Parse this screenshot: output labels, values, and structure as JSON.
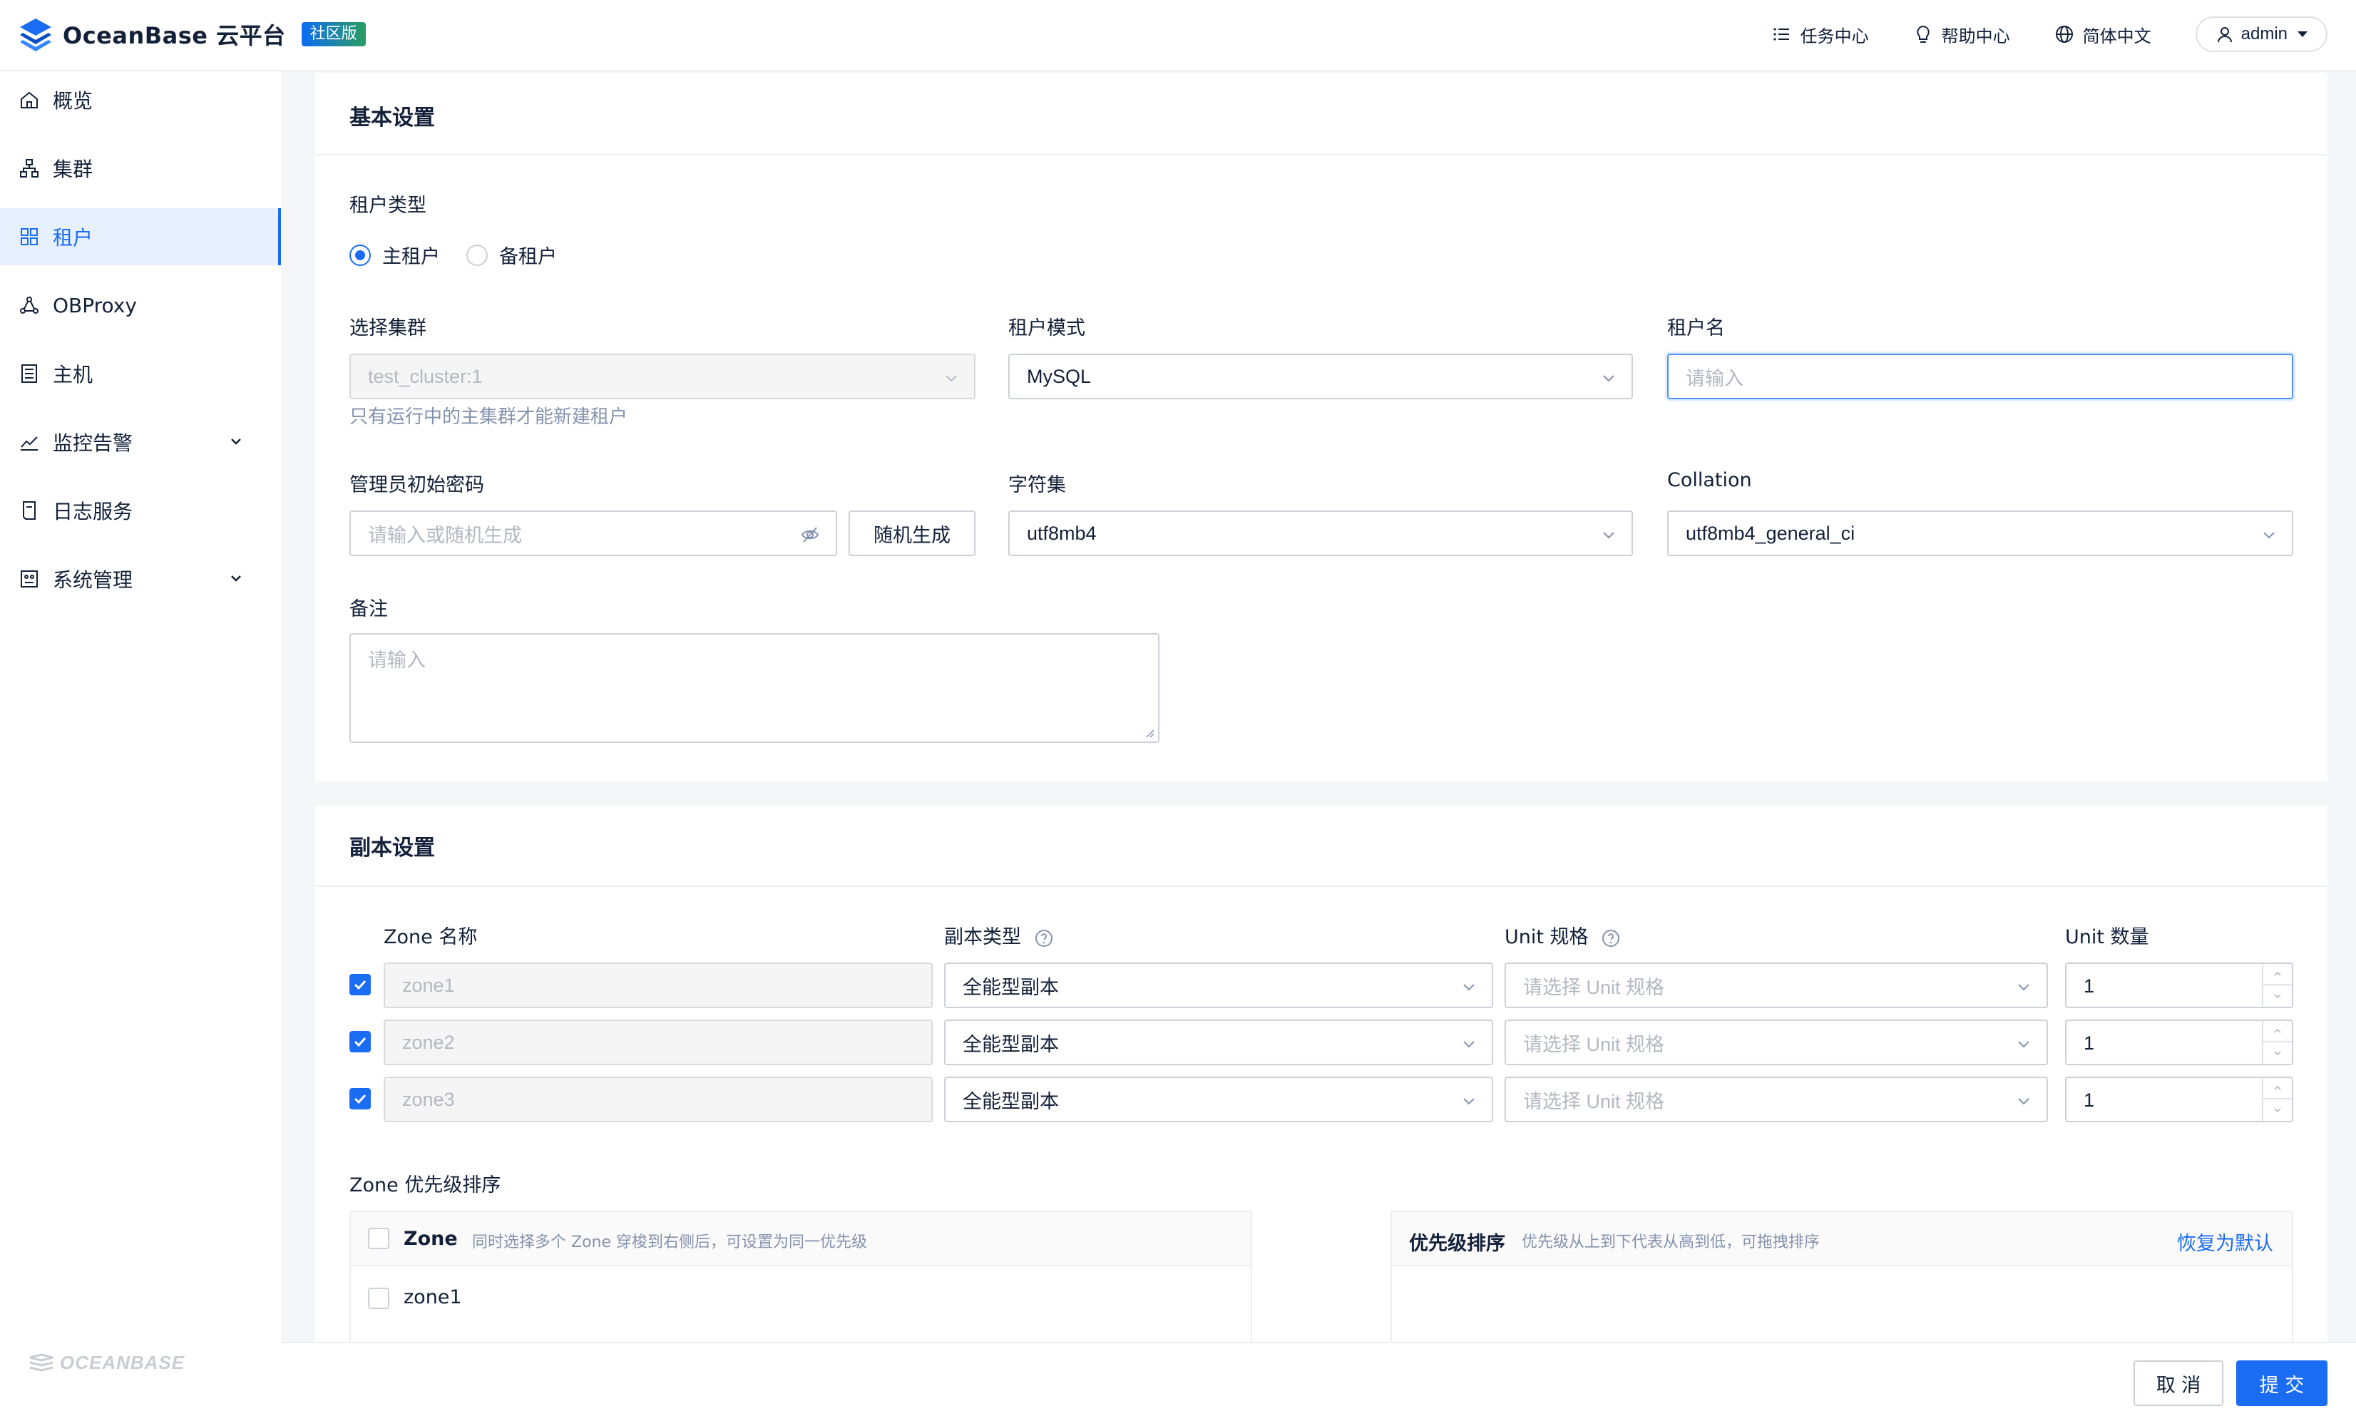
{
  "header": {
    "logo_text": "OceanBase 云平台",
    "edition_badge": "社区版",
    "task_center": "任务中心",
    "help_center": "帮助中心",
    "language": "简体中文",
    "user": "admin"
  },
  "sidebar": {
    "items": [
      {
        "label": "概览",
        "icon": "home-icon"
      },
      {
        "label": "集群",
        "icon": "cluster-icon"
      },
      {
        "label": "租户",
        "icon": "grid-icon",
        "active": true
      },
      {
        "label": "OBProxy",
        "icon": "proxy-icon"
      },
      {
        "label": "主机",
        "icon": "host-icon"
      },
      {
        "label": "监控告警",
        "icon": "chart-line-icon",
        "expandable": true
      },
      {
        "label": "日志服务",
        "icon": "document-icon"
      },
      {
        "label": "系统管理",
        "icon": "settings-panel-icon",
        "expandable": true
      }
    ],
    "footer_logo": "OCEANBASE"
  },
  "basic": {
    "title": "基本设置",
    "tenant_type_label": "租户类型",
    "tenant_type_options": [
      "主租户",
      "备租户"
    ],
    "tenant_type_selected": "主租户",
    "cluster_label": "选择集群",
    "cluster_value": "test_cluster:1",
    "cluster_hint": "只有运行中的主集群才能新建租户",
    "mode_label": "租户模式",
    "mode_value": "MySQL",
    "name_label": "租户名",
    "name_placeholder": "请输入",
    "password_label": "管理员初始密码",
    "password_placeholder": "请输入或随机生成",
    "random_button": "随机生成",
    "charset_label": "字符集",
    "charset_value": "utf8mb4",
    "collation_label": "Collation",
    "collation_value": "utf8mb4_general_ci",
    "remark_label": "备注",
    "remark_placeholder": "请输入"
  },
  "replica": {
    "title": "副本设置",
    "col_zone": "Zone 名称",
    "col_type": "副本类型",
    "col_unit_spec": "Unit 规格",
    "col_unit_count": "Unit 数量",
    "rows": [
      {
        "zone": "zone1",
        "type": "全能型副本",
        "unit_spec_placeholder": "请选择 Unit 规格",
        "count": "1",
        "checked": true
      },
      {
        "zone": "zone2",
        "type": "全能型副本",
        "unit_spec_placeholder": "请选择 Unit 规格",
        "count": "1",
        "checked": true
      },
      {
        "zone": "zone3",
        "type": "全能型副本",
        "unit_spec_placeholder": "请选择 Unit 规格",
        "count": "1",
        "checked": true
      }
    ],
    "priority_label": "Zone 优先级排序",
    "left_panel_head": "Zone",
    "left_panel_hint": "同时选择多个 Zone 穿梭到右侧后，可设置为同一优先级",
    "left_panel_items": [
      "zone1"
    ],
    "right_panel_head": "优先级排序",
    "right_panel_hint": "优先级从上到下代表从高到低，可拖拽排序",
    "reset_link": "恢复为默认"
  },
  "footer": {
    "cancel": "取 消",
    "submit": "提 交"
  },
  "colors": {
    "primary": "#1a6cf2",
    "active_bg": "#e6f0ff"
  }
}
